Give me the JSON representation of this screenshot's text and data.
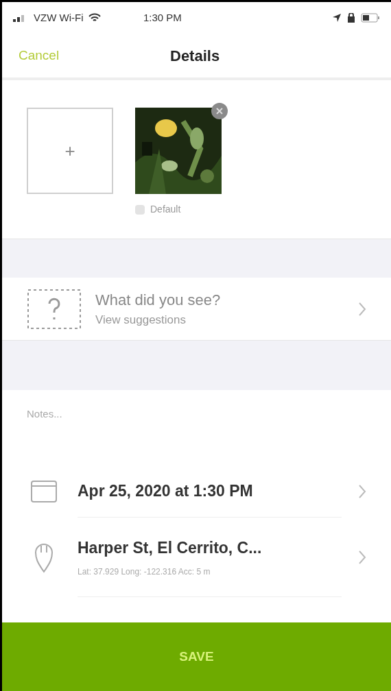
{
  "status_bar": {
    "carrier": "VZW Wi-Fi",
    "time": "1:30 PM"
  },
  "nav": {
    "cancel": "Cancel",
    "title": "Details"
  },
  "photos": {
    "add_label": "+",
    "items": [
      {
        "kind": "picture",
        "default_label": "Default",
        "default_checked": false
      }
    ]
  },
  "species": {
    "title": "What did you see?",
    "subtitle": "View suggestions"
  },
  "notes": {
    "placeholder": "Notes..."
  },
  "details": [
    {
      "kind": "date",
      "title": "Apr 25, 2020 at 1:30 PM"
    },
    {
      "kind": "location",
      "title": "Harper St, El Cerrito, C...",
      "subtitle": "Lat: 37.929  Long: -122.316  Acc: 5 m"
    }
  ],
  "save": "SAVE"
}
